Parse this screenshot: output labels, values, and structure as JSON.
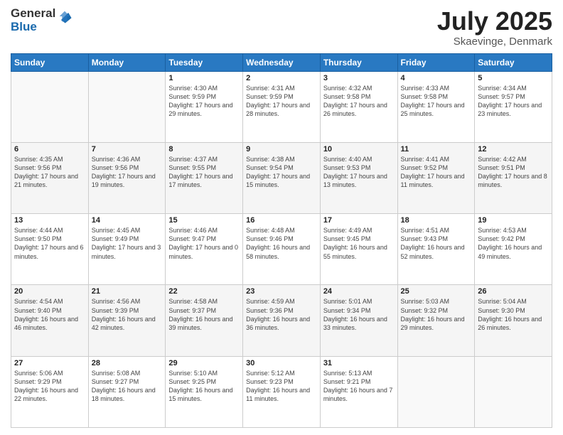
{
  "logo": {
    "general": "General",
    "blue": "Blue"
  },
  "header": {
    "title": "July 2025",
    "subtitle": "Skaevinge, Denmark"
  },
  "weekdays": [
    "Sunday",
    "Monday",
    "Tuesday",
    "Wednesday",
    "Thursday",
    "Friday",
    "Saturday"
  ],
  "weeks": [
    [
      {
        "day": "",
        "sunrise": "",
        "sunset": "",
        "daylight": ""
      },
      {
        "day": "",
        "sunrise": "",
        "sunset": "",
        "daylight": ""
      },
      {
        "day": "1",
        "sunrise": "Sunrise: 4:30 AM",
        "sunset": "Sunset: 9:59 PM",
        "daylight": "Daylight: 17 hours and 29 minutes."
      },
      {
        "day": "2",
        "sunrise": "Sunrise: 4:31 AM",
        "sunset": "Sunset: 9:59 PM",
        "daylight": "Daylight: 17 hours and 28 minutes."
      },
      {
        "day": "3",
        "sunrise": "Sunrise: 4:32 AM",
        "sunset": "Sunset: 9:58 PM",
        "daylight": "Daylight: 17 hours and 26 minutes."
      },
      {
        "day": "4",
        "sunrise": "Sunrise: 4:33 AM",
        "sunset": "Sunset: 9:58 PM",
        "daylight": "Daylight: 17 hours and 25 minutes."
      },
      {
        "day": "5",
        "sunrise": "Sunrise: 4:34 AM",
        "sunset": "Sunset: 9:57 PM",
        "daylight": "Daylight: 17 hours and 23 minutes."
      }
    ],
    [
      {
        "day": "6",
        "sunrise": "Sunrise: 4:35 AM",
        "sunset": "Sunset: 9:56 PM",
        "daylight": "Daylight: 17 hours and 21 minutes."
      },
      {
        "day": "7",
        "sunrise": "Sunrise: 4:36 AM",
        "sunset": "Sunset: 9:56 PM",
        "daylight": "Daylight: 17 hours and 19 minutes."
      },
      {
        "day": "8",
        "sunrise": "Sunrise: 4:37 AM",
        "sunset": "Sunset: 9:55 PM",
        "daylight": "Daylight: 17 hours and 17 minutes."
      },
      {
        "day": "9",
        "sunrise": "Sunrise: 4:38 AM",
        "sunset": "Sunset: 9:54 PM",
        "daylight": "Daylight: 17 hours and 15 minutes."
      },
      {
        "day": "10",
        "sunrise": "Sunrise: 4:40 AM",
        "sunset": "Sunset: 9:53 PM",
        "daylight": "Daylight: 17 hours and 13 minutes."
      },
      {
        "day": "11",
        "sunrise": "Sunrise: 4:41 AM",
        "sunset": "Sunset: 9:52 PM",
        "daylight": "Daylight: 17 hours and 11 minutes."
      },
      {
        "day": "12",
        "sunrise": "Sunrise: 4:42 AM",
        "sunset": "Sunset: 9:51 PM",
        "daylight": "Daylight: 17 hours and 8 minutes."
      }
    ],
    [
      {
        "day": "13",
        "sunrise": "Sunrise: 4:44 AM",
        "sunset": "Sunset: 9:50 PM",
        "daylight": "Daylight: 17 hours and 6 minutes."
      },
      {
        "day": "14",
        "sunrise": "Sunrise: 4:45 AM",
        "sunset": "Sunset: 9:49 PM",
        "daylight": "Daylight: 17 hours and 3 minutes."
      },
      {
        "day": "15",
        "sunrise": "Sunrise: 4:46 AM",
        "sunset": "Sunset: 9:47 PM",
        "daylight": "Daylight: 17 hours and 0 minutes."
      },
      {
        "day": "16",
        "sunrise": "Sunrise: 4:48 AM",
        "sunset": "Sunset: 9:46 PM",
        "daylight": "Daylight: 16 hours and 58 minutes."
      },
      {
        "day": "17",
        "sunrise": "Sunrise: 4:49 AM",
        "sunset": "Sunset: 9:45 PM",
        "daylight": "Daylight: 16 hours and 55 minutes."
      },
      {
        "day": "18",
        "sunrise": "Sunrise: 4:51 AM",
        "sunset": "Sunset: 9:43 PM",
        "daylight": "Daylight: 16 hours and 52 minutes."
      },
      {
        "day": "19",
        "sunrise": "Sunrise: 4:53 AM",
        "sunset": "Sunset: 9:42 PM",
        "daylight": "Daylight: 16 hours and 49 minutes."
      }
    ],
    [
      {
        "day": "20",
        "sunrise": "Sunrise: 4:54 AM",
        "sunset": "Sunset: 9:40 PM",
        "daylight": "Daylight: 16 hours and 46 minutes."
      },
      {
        "day": "21",
        "sunrise": "Sunrise: 4:56 AM",
        "sunset": "Sunset: 9:39 PM",
        "daylight": "Daylight: 16 hours and 42 minutes."
      },
      {
        "day": "22",
        "sunrise": "Sunrise: 4:58 AM",
        "sunset": "Sunset: 9:37 PM",
        "daylight": "Daylight: 16 hours and 39 minutes."
      },
      {
        "day": "23",
        "sunrise": "Sunrise: 4:59 AM",
        "sunset": "Sunset: 9:36 PM",
        "daylight": "Daylight: 16 hours and 36 minutes."
      },
      {
        "day": "24",
        "sunrise": "Sunrise: 5:01 AM",
        "sunset": "Sunset: 9:34 PM",
        "daylight": "Daylight: 16 hours and 33 minutes."
      },
      {
        "day": "25",
        "sunrise": "Sunrise: 5:03 AM",
        "sunset": "Sunset: 9:32 PM",
        "daylight": "Daylight: 16 hours and 29 minutes."
      },
      {
        "day": "26",
        "sunrise": "Sunrise: 5:04 AM",
        "sunset": "Sunset: 9:30 PM",
        "daylight": "Daylight: 16 hours and 26 minutes."
      }
    ],
    [
      {
        "day": "27",
        "sunrise": "Sunrise: 5:06 AM",
        "sunset": "Sunset: 9:29 PM",
        "daylight": "Daylight: 16 hours and 22 minutes."
      },
      {
        "day": "28",
        "sunrise": "Sunrise: 5:08 AM",
        "sunset": "Sunset: 9:27 PM",
        "daylight": "Daylight: 16 hours and 18 minutes."
      },
      {
        "day": "29",
        "sunrise": "Sunrise: 5:10 AM",
        "sunset": "Sunset: 9:25 PM",
        "daylight": "Daylight: 16 hours and 15 minutes."
      },
      {
        "day": "30",
        "sunrise": "Sunrise: 5:12 AM",
        "sunset": "Sunset: 9:23 PM",
        "daylight": "Daylight: 16 hours and 11 minutes."
      },
      {
        "day": "31",
        "sunrise": "Sunrise: 5:13 AM",
        "sunset": "Sunset: 9:21 PM",
        "daylight": "Daylight: 16 hours and 7 minutes."
      },
      {
        "day": "",
        "sunrise": "",
        "sunset": "",
        "daylight": ""
      },
      {
        "day": "",
        "sunrise": "",
        "sunset": "",
        "daylight": ""
      }
    ]
  ]
}
